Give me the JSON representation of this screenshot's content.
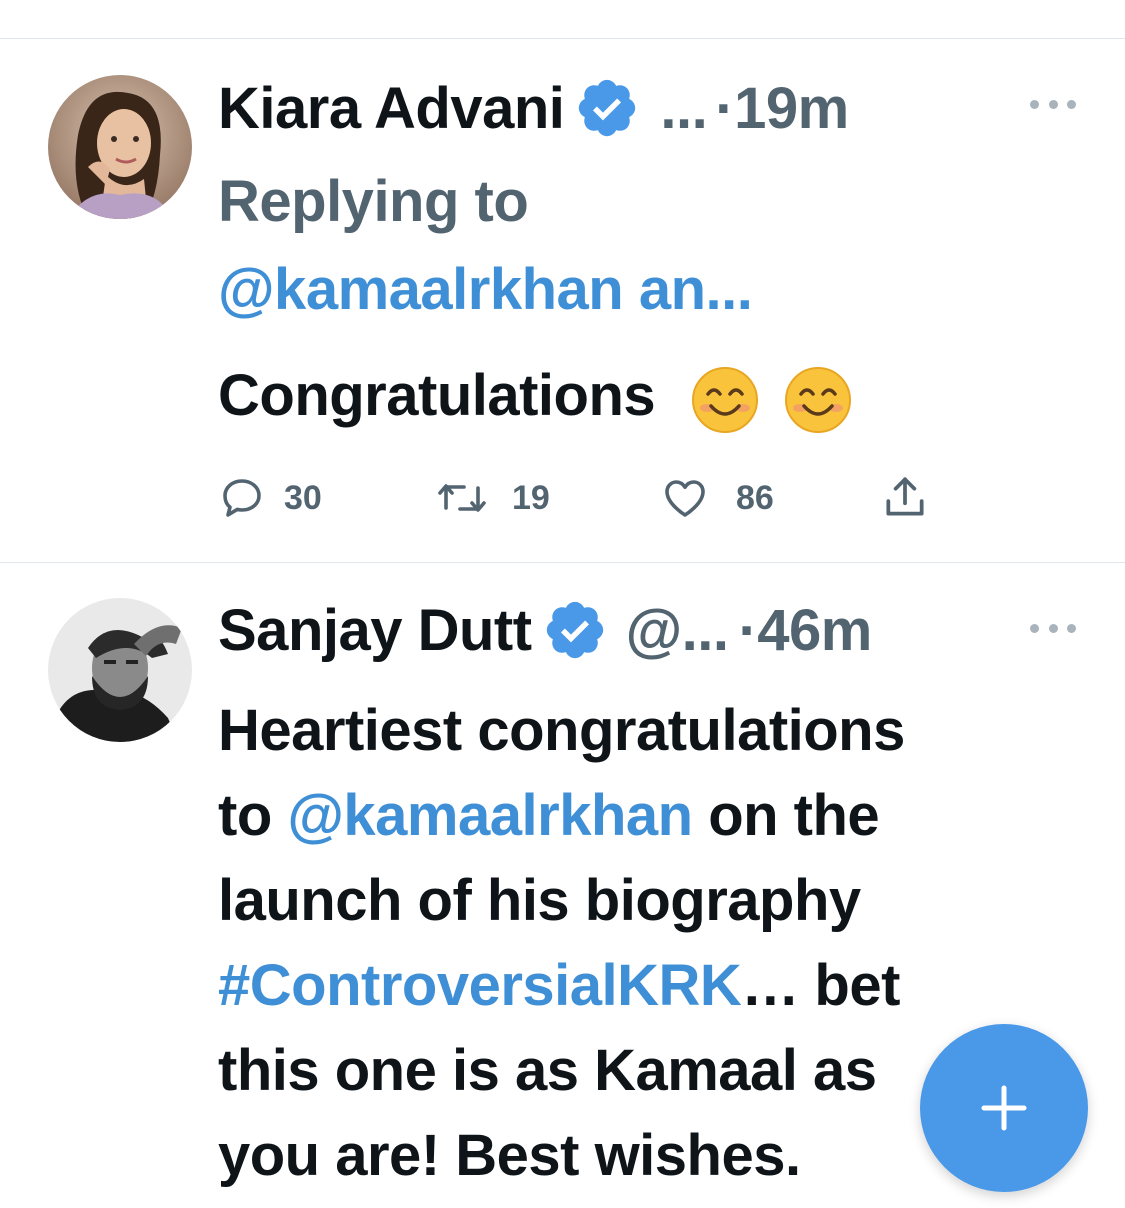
{
  "tweets": [
    {
      "author": "Kiara Advani",
      "handle": "...",
      "time": "·19m",
      "replying_label": "Replying to",
      "replying_to": "@kamaalrkhan an...",
      "text": "Congratulations",
      "emojis": [
        "smiling-face-icon",
        "smiling-face-icon"
      ],
      "stats": {
        "replies": "30",
        "retweets": "19",
        "likes": "86"
      }
    },
    {
      "author": "Sanjay Dutt",
      "handle": "@...",
      "time": "·46m",
      "text_parts": {
        "l1": "Heartiest congratulations",
        "l2_a": "to ",
        "l2_mention": "@kamaalrkhan",
        "l2_b": " on the",
        "l3": "launch of his biography",
        "l4_hashtag": "#ControversialKRK",
        "l4_b": "… bet",
        "l5": "this one is as Kamaal as",
        "l6": "you are! Best wishes."
      }
    }
  ],
  "colors": {
    "link": "#3f8fd6",
    "verified": "#4a99e9",
    "fab": "#4a99e9",
    "muted": "#536471"
  },
  "fab_icon": "plus-icon"
}
